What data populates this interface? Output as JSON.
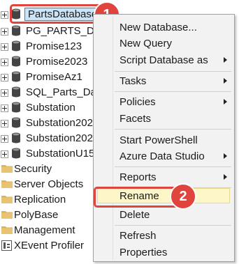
{
  "tree": {
    "databases": [
      "PartsDatabase",
      "PG_PARTS_DB",
      "Promise123",
      "Promise2023",
      "PromiseAz1",
      "SQL_Parts_Dat",
      "Substation",
      "Substation202",
      "Substation202",
      "SubstationU15"
    ],
    "folders": [
      "Security",
      "Server Objects",
      "Replication",
      "PolyBase",
      "Management"
    ],
    "xevent_label": "XEvent Profiler"
  },
  "context_menu": {
    "items": [
      {
        "label": "New Database..."
      },
      {
        "label": "New Query"
      },
      {
        "label": "Script Database as"
      },
      {
        "label": "Tasks"
      },
      {
        "label": "Policies"
      },
      {
        "label": "Facets"
      },
      {
        "label": "Start PowerShell"
      },
      {
        "label": "Azure Data Studio"
      },
      {
        "label": "Reports"
      },
      {
        "label": "Rename"
      },
      {
        "label": "Delete"
      },
      {
        "label": "Refresh"
      },
      {
        "label": "Properties"
      }
    ]
  },
  "callouts": [
    "1",
    "2"
  ],
  "colors": {
    "callout": "#e0453d",
    "selection": "#cce4f7",
    "menu_background": "#f2f2f2",
    "rename_highlight": "#fcf6c8",
    "folder": "#dcb35c"
  }
}
